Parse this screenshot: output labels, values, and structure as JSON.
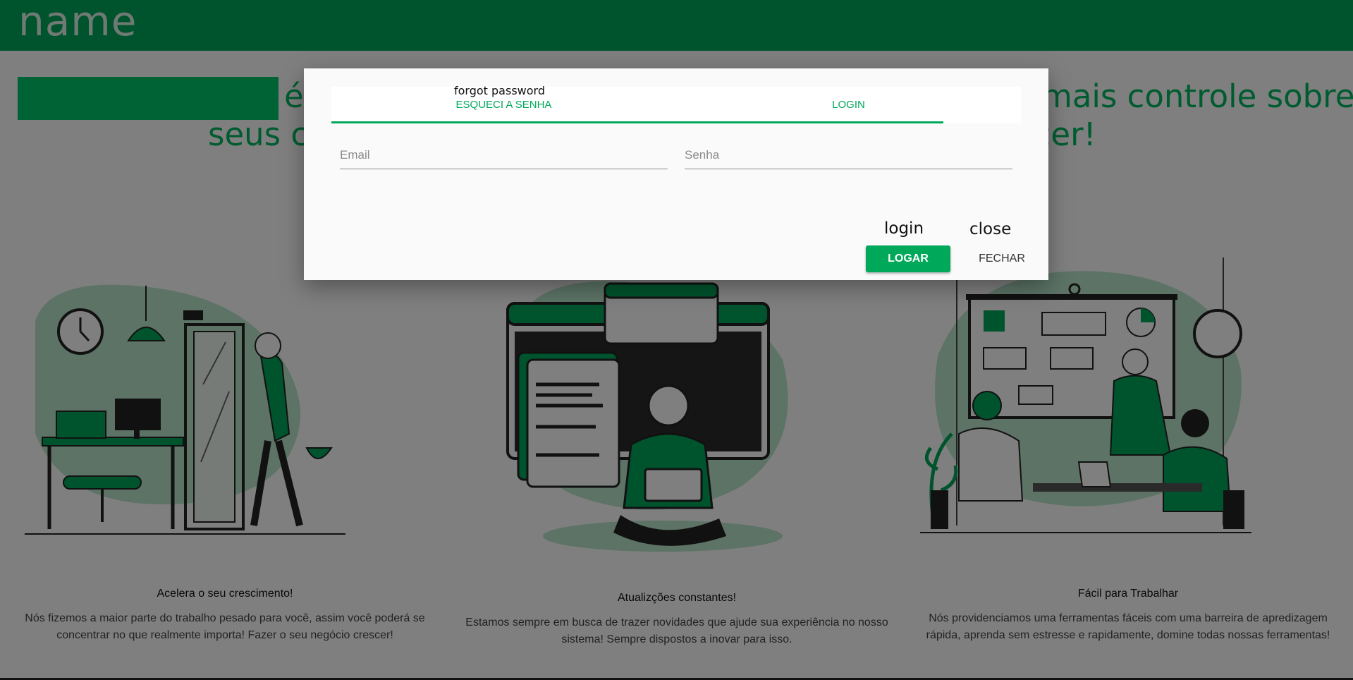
{
  "header": {
    "brand": "name",
    "color": "#00a85a"
  },
  "hero": {
    "line1_left": "é",
    "line1_right": "mais controle sobre",
    "line2_left": "seus c",
    "line2_right": "rescer!"
  },
  "features": [
    {
      "title": "Acelera o seu crescimento!",
      "text": "Nós fizemos a maior parte do trabalho pesado para você, assim você poderá se concentrar no que realmente importa! Fazer o seu negócio crescer!"
    },
    {
      "title": "Atualizções constantes!",
      "text": "Estamos sempre em busca de trazer novidades que ajude sua experiência no nosso sistema! Sempre dispostos a inovar para isso."
    },
    {
      "title": "Fácil para Trabalhar",
      "text": "Nós providenciamos uma ferramentas fáceis com uma barreira de apredizagem rápida, aprenda sem estresse e rapidamente, domine todas nossas ferramentas!"
    }
  ],
  "dialog": {
    "tabs": [
      "ESQUECI A SENHA",
      "LOGIN"
    ],
    "email_placeholder": "Email",
    "senha_placeholder": "Senha",
    "logar_label": "LOGAR",
    "fechar_label": "FECHAR"
  },
  "annotations": {
    "forgot": "forgot password",
    "login": "login",
    "close": "close"
  },
  "illustrations": {
    "left": "office-exit-illustration",
    "center": "developer-laptop-illustration",
    "right": "team-presentation-illustration"
  }
}
